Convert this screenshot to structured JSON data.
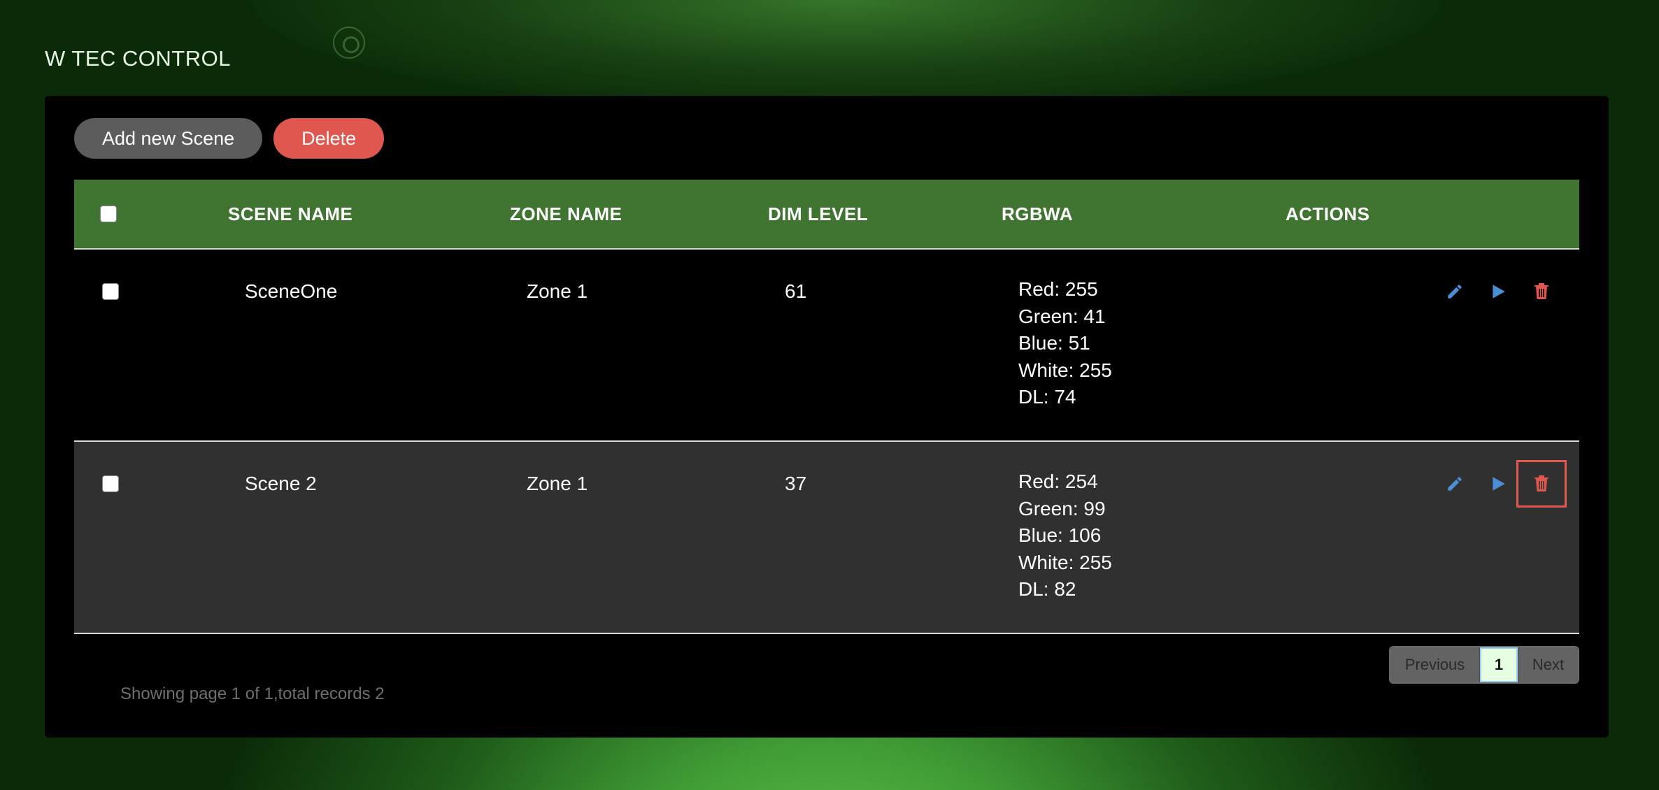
{
  "app": {
    "title": "W TEC CONTROL"
  },
  "toolbar": {
    "add_label": "Add new Scene",
    "delete_label": "Delete"
  },
  "table": {
    "columns": [
      "SCENE NAME",
      "ZONE NAME",
      "DIM LEVEL",
      "RGBWA",
      "ACTIONS"
    ],
    "rows": [
      {
        "scene_name": "SceneOne",
        "zone_name": "Zone 1",
        "dim_level": "61",
        "rgbwa": [
          "Red: 255",
          "Green: 41",
          "Blue: 51",
          "White: 255",
          "DL: 74"
        ]
      },
      {
        "scene_name": "Scene 2",
        "zone_name": "Zone 1",
        "dim_level": "37",
        "rgbwa": [
          "Red: 254",
          "Green: 99",
          "Blue: 106",
          "White: 255",
          "DL: 82"
        ]
      }
    ]
  },
  "pagination": {
    "previous_label": "Previous",
    "current_page": "1",
    "next_label": "Next"
  },
  "status": {
    "text": "Showing page 1 of 1,total records 2"
  },
  "colors": {
    "header_green": "#3f7531",
    "delete_red": "#e0574f",
    "action_blue": "#4a8fd6"
  },
  "icons": {
    "edit": "pencil-icon",
    "play": "play-icon",
    "delete": "trash-icon"
  }
}
